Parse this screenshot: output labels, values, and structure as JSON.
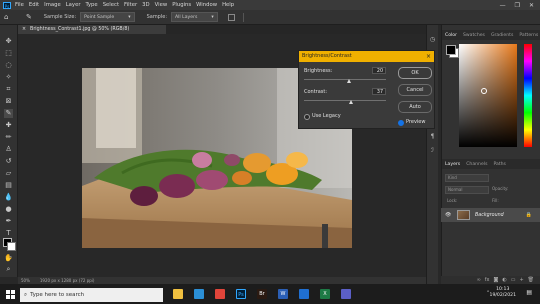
{
  "menubar": {
    "app_icon": "Ps",
    "items": [
      "File",
      "Edit",
      "Image",
      "Layer",
      "Type",
      "Select",
      "Filter",
      "3D",
      "View",
      "Plugins",
      "Window",
      "Help"
    ],
    "window_controls": [
      "—",
      "❐",
      "✕"
    ]
  },
  "options_bar": {
    "sample_size_label": "Sample Size:",
    "sample_size_value": "Point Sample",
    "sample_label": "Sample:",
    "sample_value": "All Layers"
  },
  "document": {
    "tab_title": "Brightness_Contrast1.jpg @ 50% (RGB/8)",
    "close": "×"
  },
  "status": {
    "zoom": "50%",
    "doc_info": "1920 px x 1280 px (72 ppi)"
  },
  "right_panel": {
    "color_tabs": [
      "Color",
      "Swatches",
      "Gradients",
      "Patterns"
    ],
    "layers_tabs": [
      "Layers",
      "Channels",
      "Paths"
    ],
    "kind_label": "Kind",
    "blend_mode": "Normal",
    "opacity_label": "Opacity:",
    "lock_label": "Lock:",
    "fill_label": "Fill:",
    "layer_name": "Background"
  },
  "dialog": {
    "title": "Brightness/Contrast",
    "brightness_label": "Brightness:",
    "brightness_value": "20",
    "brightness_fraction": 0.55,
    "contrast_label": "Contrast:",
    "contrast_value": "37",
    "contrast_fraction": 0.58,
    "ok_label": "OK",
    "cancel_label": "Cancel",
    "auto_label": "Auto",
    "legacy_label": "Use Legacy",
    "legacy_checked": false,
    "preview_label": "Preview",
    "preview_checked": true
  },
  "taskbar": {
    "search_placeholder": "Type here to search",
    "time": "10:13",
    "date": "19/02/2021",
    "apps": [
      {
        "name": "file-explorer-icon",
        "label": "",
        "color": "#f0c040"
      },
      {
        "name": "edge-icon",
        "label": "",
        "color": "#2b8fd6"
      },
      {
        "name": "chrome-icon",
        "label": "",
        "color": "#e0453a"
      },
      {
        "name": "photoshop-icon",
        "label": "Ps",
        "color": "#001e36"
      },
      {
        "name": "bridge-icon",
        "label": "Br",
        "color": "#2a1a12"
      },
      {
        "name": "word-icon",
        "label": "W",
        "color": "#2b5fb5"
      },
      {
        "name": "mail-icon",
        "label": "",
        "color": "#1f6fd1"
      },
      {
        "name": "excel-icon",
        "label": "X",
        "color": "#1d7a45"
      },
      {
        "name": "teams-icon",
        "label": "",
        "color": "#5b5fc7"
      }
    ]
  }
}
